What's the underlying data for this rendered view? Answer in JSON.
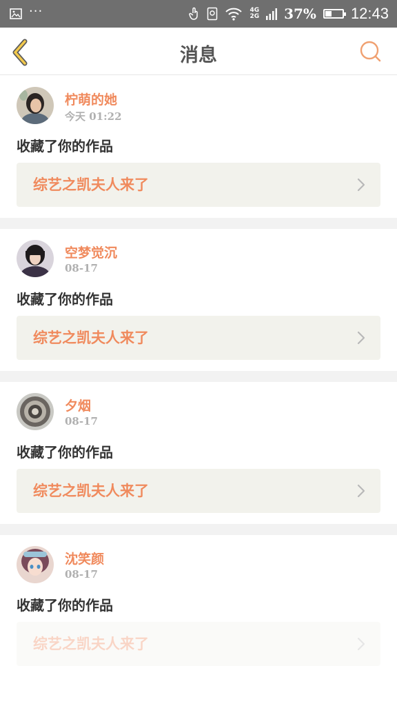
{
  "status_bar": {
    "dots": "···",
    "net_top": "4G",
    "net_bottom": "2G",
    "battery_percent": "37%",
    "battery_level": 0.37,
    "time": "12:43"
  },
  "nav": {
    "title": "消息",
    "back_icon": "chevron-left-icon",
    "search_icon": "search-icon",
    "accent": "#f2c94c"
  },
  "messages": [
    {
      "name": "柠萌的她",
      "time": "今天 01:22",
      "action": "收藏了你的作品",
      "work_title": "综艺之凯夫人来了"
    },
    {
      "name": "空梦觉沉",
      "time": "08-17",
      "action": "收藏了你的作品",
      "work_title": "综艺之凯夫人来了"
    },
    {
      "name": "夕烟",
      "time": "08-17",
      "action": "收藏了你的作品",
      "work_title": "综艺之凯夫人来了"
    },
    {
      "name": "沈笑颜",
      "time": "08-17",
      "action": "收藏了你的作品",
      "work_title": "综艺之凯夫人来了"
    }
  ],
  "colors": {
    "name": "#f08a5d",
    "work_bg": "#f2f2ec",
    "statusbar": "#6f6f6f"
  }
}
